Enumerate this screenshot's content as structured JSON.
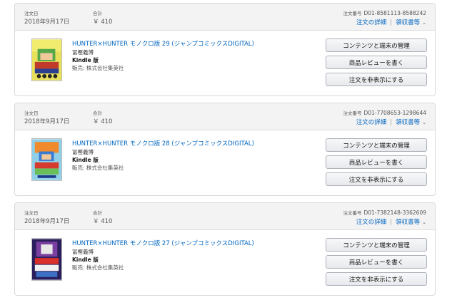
{
  "labels": {
    "order_date": "注文日",
    "total": "合計",
    "order_number": "注文番号",
    "order_details": "注文の詳細",
    "receipt": "領収書等",
    "seller_prefix": "販売:"
  },
  "buttons": {
    "content_devices": "コンテンツと端末の管理",
    "write_review": "商品レビューを書く",
    "hide_order": "注文を非表示にする"
  },
  "orders": [
    {
      "date": "2018年9月17日",
      "total": "￥ 410",
      "order_id": "D01-8581113-8588242",
      "title": "HUNTER×HUNTER モノクロ版 29 (ジャンプコミックスDIGITAL)",
      "author": "冨樫義博",
      "format": "Kindle 版",
      "seller": "株式会社集英社"
    },
    {
      "date": "2018年9月17日",
      "total": "￥ 410",
      "order_id": "D01-7708653-1298644",
      "title": "HUNTER×HUNTER モノクロ版 28 (ジャンプコミックスDIGITAL)",
      "author": "冨樫義博",
      "format": "Kindle 版",
      "seller": "株式会社集英社"
    },
    {
      "date": "2018年9月17日",
      "total": "￥ 410",
      "order_id": "D01-7382148-3362609",
      "title": "HUNTER×HUNTER モノクロ版 27 (ジャンプコミックスDIGITAL)",
      "author": "冨樫義博",
      "format": "Kindle 版",
      "seller": "株式会社集英社"
    }
  ],
  "colors": {
    "link": "#0066c0",
    "header_bg": "#f3f3f3",
    "border": "#d8d8d8"
  }
}
